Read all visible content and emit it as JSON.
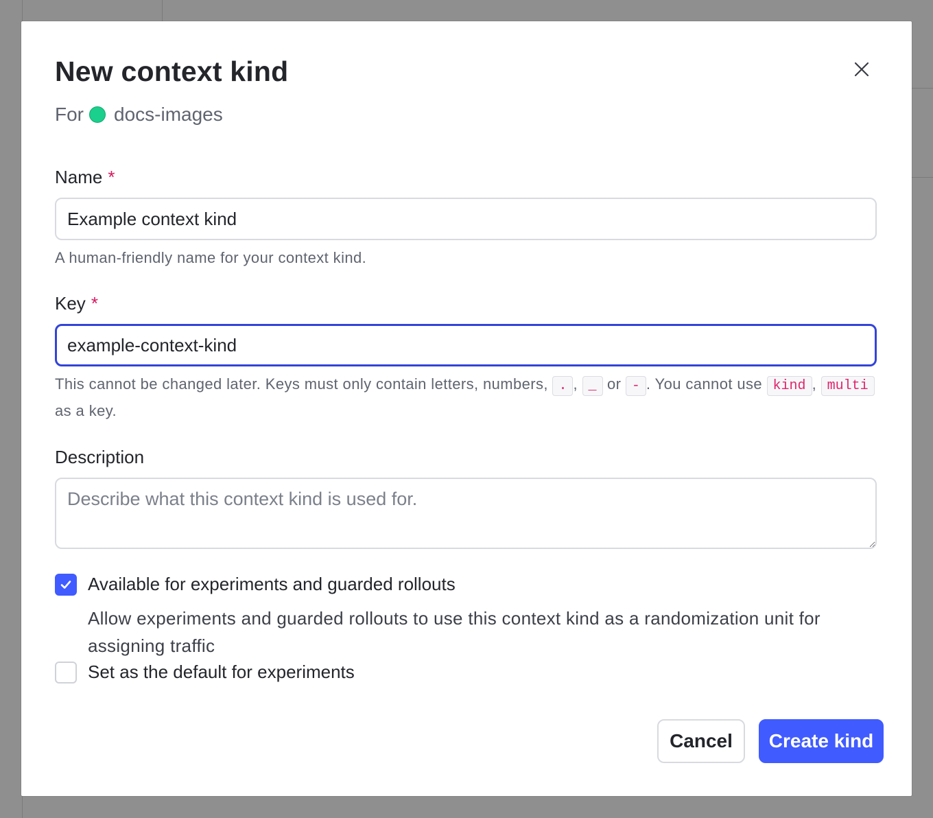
{
  "dialog": {
    "title": "New context kind",
    "for_label": "For",
    "project_name": "docs-images",
    "project_color": "#1bd08c"
  },
  "name_field": {
    "label": "Name",
    "required_marker": "*",
    "value": "Example context kind",
    "hint": "A human-friendly name for your context kind."
  },
  "key_field": {
    "label": "Key",
    "required_marker": "*",
    "value": "example-context-kind",
    "hint_part1": "This cannot be changed later. Keys must only contain letters, numbers, ",
    "char_dot": ".",
    "sep_comma": ", ",
    "char_underscore": "_",
    "sep_or": " or ",
    "char_dash": "-",
    "hint_part2": ". You cannot use ",
    "reserved_kind": "kind",
    "sep_comma2": ",",
    "reserved_multi": "multi",
    "hint_part3": " as a key."
  },
  "description_field": {
    "label": "Description",
    "placeholder": "Describe what this context kind is used for."
  },
  "experiments_option": {
    "label": "Available for experiments and guarded rollouts",
    "checked": true,
    "description": "Allow experiments and guarded rollouts to use this context kind as a randomization unit for assigning traffic"
  },
  "default_option": {
    "label": "Set as the default for experiments",
    "checked": false
  },
  "actions": {
    "cancel_label": "Cancel",
    "create_label": "Create kind"
  },
  "colors": {
    "primary": "#405bff",
    "focus_border": "#3344d8",
    "required": "#d6185e",
    "code_text": "#e0246a"
  }
}
